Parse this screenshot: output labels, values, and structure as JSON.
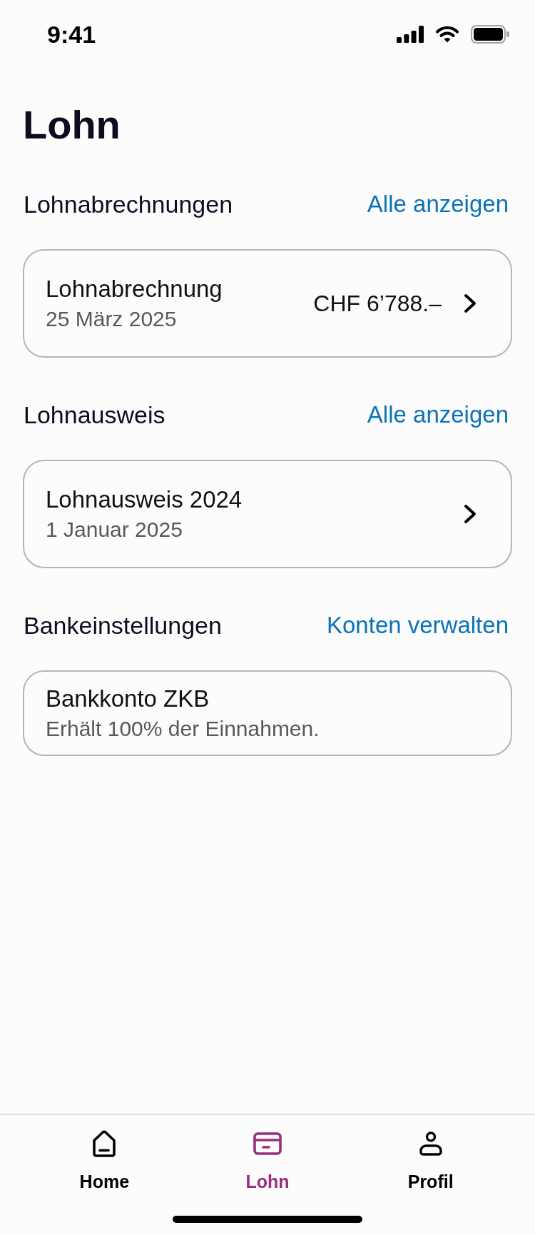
{
  "status_bar": {
    "time": "9:41"
  },
  "title": "Lohn",
  "sections": [
    {
      "heading": "Lohnabrechnungen",
      "action": "Alle anzeigen",
      "card": {
        "kind": "link",
        "title": "Lohnabrechnung",
        "subtitle": "25 März 2025",
        "amount": "CHF 6’788.–"
      }
    },
    {
      "heading": "Lohnausweis",
      "action": "Alle anzeigen",
      "card": {
        "kind": "link",
        "title": "Lohnausweis 2024",
        "subtitle": "1 Januar 2025"
      }
    },
    {
      "heading": "Bankeinstellungen",
      "action": "Konten verwalten",
      "card": {
        "kind": "info",
        "title": "Bankkonto ZKB",
        "subtitle": "Erhält 100% der Einnahmen."
      }
    }
  ],
  "tab_bar": [
    {
      "label": "Home",
      "selected": false
    },
    {
      "label": "Lohn",
      "selected": true
    },
    {
      "label": "Profil",
      "selected": false
    }
  ]
}
